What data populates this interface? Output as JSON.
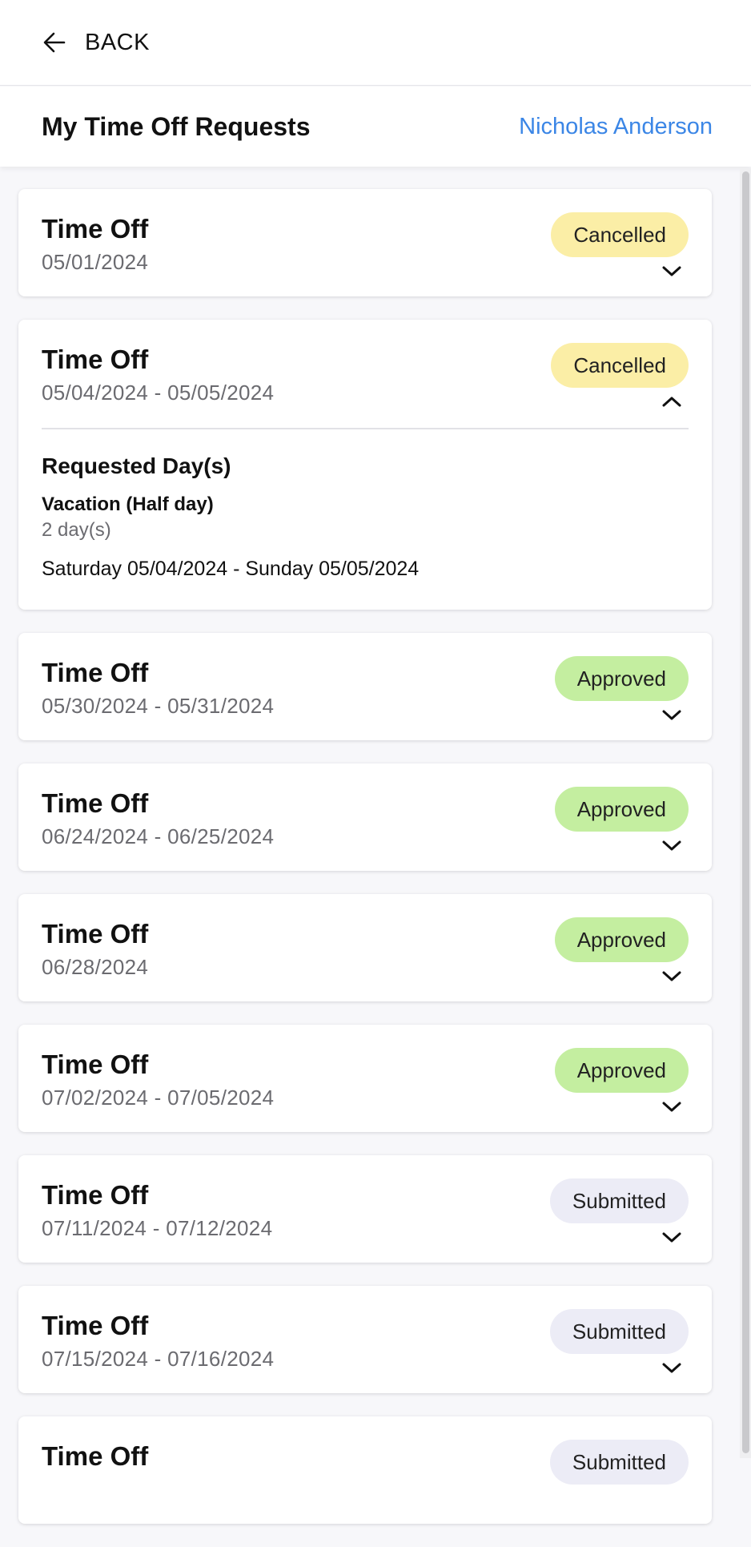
{
  "nav": {
    "back_label": "BACK"
  },
  "header": {
    "title": "My Time Off Requests",
    "user_name": "Nicholas Anderson"
  },
  "colors": {
    "accent": "#3b86e6",
    "cancelled": "#fbeea6",
    "approved": "#c4eea0",
    "submitted": "#ececf6"
  },
  "requests": [
    {
      "title": "Time Off",
      "dates": "05/01/2024",
      "status": "Cancelled"
    },
    {
      "title": "Time Off",
      "dates": "05/04/2024 - 05/05/2024",
      "status": "Cancelled",
      "details": {
        "heading": "Requested Day(s)",
        "type": "Vacation (Half day)",
        "count": "2 day(s)",
        "range": "Saturday 05/04/2024 - Sunday 05/05/2024"
      }
    },
    {
      "title": "Time Off",
      "dates": "05/30/2024 - 05/31/2024",
      "status": "Approved"
    },
    {
      "title": "Time Off",
      "dates": "06/24/2024 - 06/25/2024",
      "status": "Approved"
    },
    {
      "title": "Time Off",
      "dates": "06/28/2024",
      "status": "Approved"
    },
    {
      "title": "Time Off",
      "dates": "07/02/2024 - 07/05/2024",
      "status": "Approved"
    },
    {
      "title": "Time Off",
      "dates": "07/11/2024 - 07/12/2024",
      "status": "Submitted"
    },
    {
      "title": "Time Off",
      "dates": "07/15/2024 - 07/16/2024",
      "status": "Submitted"
    },
    {
      "title": "Time Off",
      "dates": "",
      "status": "Submitted"
    }
  ]
}
